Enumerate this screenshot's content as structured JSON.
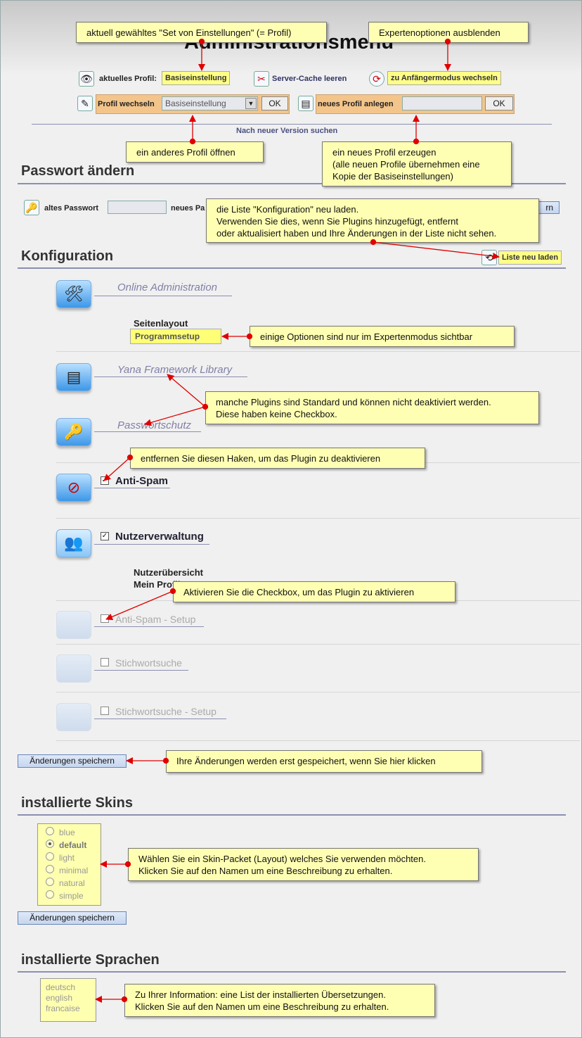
{
  "page": {
    "title": "Administrationsmenü"
  },
  "header": {
    "profile_label": "aktuelles Profil:",
    "profile_value": "Basiseinstellung",
    "cache_label": "Server-Cache leeren",
    "beginner_label": "zu Anfängermodus wechseln",
    "switch_profile_label": "Profil wechseln",
    "switch_profile_select": "Basiseinstellung",
    "ok": "OK",
    "new_profile_label": "neues Profil anlegen",
    "ok2": "OK",
    "check_version": "Nach neuer Version suchen"
  },
  "password": {
    "heading": "Passwort ändern",
    "old_label": "altes Passwort",
    "new_label": "neues Pa",
    "button_partial": "rn"
  },
  "config": {
    "heading": "Konfiguration",
    "reload_label": "Liste neu laden",
    "plugins": [
      {
        "name": "Online Administration",
        "icon": "🛠"
      },
      {
        "sub_heading": "Seitenlayout",
        "sub_button": "Programmsetup"
      },
      {
        "name": "Yana Framework Library",
        "icon": "▤"
      },
      {
        "name": "Passwortschutz",
        "icon": "🔑"
      },
      {
        "name": "Anti-Spam",
        "checked": true,
        "icon": "⊘"
      },
      {
        "name": "Nutzerverwaltung",
        "checked": true,
        "icon": "👥",
        "subs": [
          "Nutzerübersicht",
          "Mein Profil"
        ]
      },
      {
        "name": "Anti-Spam - Setup",
        "checked": false
      },
      {
        "name": "Stichwortsuche",
        "checked": false
      },
      {
        "name": "Stichwortsuche - Setup",
        "checked": false
      }
    ],
    "check_mark": "✓",
    "save": "Änderungen speichern"
  },
  "skins": {
    "heading": "installierte Skins",
    "items": [
      "blue",
      "default",
      "light",
      "minimal",
      "natural",
      "simple"
    ],
    "selected": "default",
    "save": "Änderungen speichern"
  },
  "languages": {
    "heading": "installierte Sprachen",
    "items": [
      "deutsch",
      "english",
      "francaise"
    ]
  },
  "notes": {
    "profile": "aktuell gewähltes \"Set von Einstellungen\" (= Profil)",
    "expert": "Expertenoptionen ausblenden",
    "open_profile": "ein anderes Profil öffnen",
    "new_profile": "ein neues Profil erzeugen\n(alle neuen Profile übernehmen eine\nKopie der Basiseinstellungen)",
    "reload": "die Liste \"Konfiguration\" neu laden.\nVerwenden Sie dies, wenn Sie Plugins hinzugefügt, entfernt\noder aktualisiert haben und Ihre Änderungen in der Liste nicht sehen.",
    "expert_only": "einige Optionen sind nur im Expertenmodus sichtbar",
    "standard": "manche Plugins sind Standard und können nicht deaktiviert werden.\nDiese haben keine Checkbox.",
    "uncheck": "entfernen Sie diesen Haken, um das Plugin zu deaktivieren",
    "check": "Aktivieren Sie die Checkbox, um das Plugin zu aktivieren",
    "save": "Ihre Änderungen werden erst gespeichert, wenn Sie hier klicken",
    "skin": "Wählen Sie ein Skin-Packet (Layout) welches Sie verwenden möchten.\nKlicken Sie auf den Namen um eine Beschreibung zu erhalten.",
    "lang": "Zu Ihrer Information: eine List der installierten Übersetzungen.\nKlicken Sie auf den Namen um eine Beschreibung zu erhalten."
  },
  "colors": {
    "note_bg": "#ffffb4",
    "arrow": "#e00000",
    "rule": "#8b8fb0",
    "button": "#c6d6ef"
  }
}
